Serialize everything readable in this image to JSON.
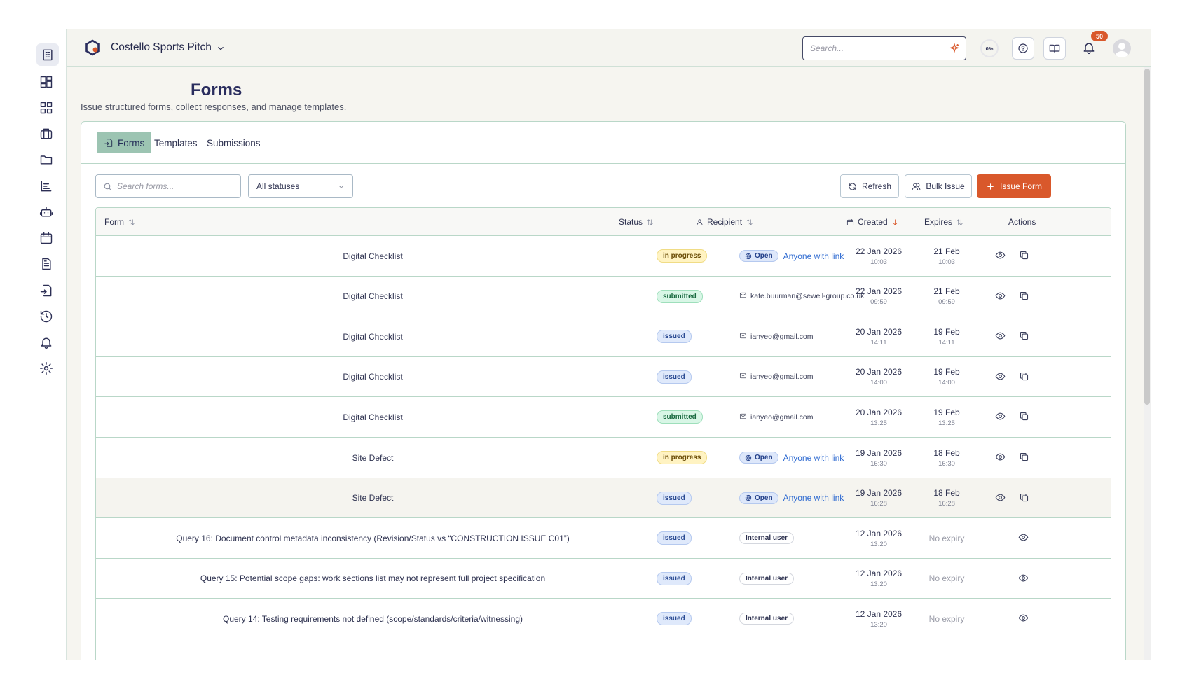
{
  "header": {
    "project_name": "Costello Sports Pitch",
    "search_placeholder": "Search...",
    "progress_label": "0%",
    "notification_count": "50"
  },
  "page": {
    "title": "Forms",
    "subtitle": "Issue structured forms, collect responses, and manage templates."
  },
  "tabs": [
    {
      "label": "Forms",
      "active": true
    },
    {
      "label": "Templates",
      "active": false
    },
    {
      "label": "Submissions",
      "active": false
    }
  ],
  "toolbar": {
    "search_placeholder": "Search forms...",
    "status_filter": "All statuses",
    "refresh_label": "Refresh",
    "bulk_issue_label": "Bulk Issue",
    "issue_form_label": "Issue Form"
  },
  "table": {
    "columns": {
      "form": "Form",
      "status": "Status",
      "recipient": "Recipient",
      "created": "Created",
      "expires": "Expires",
      "actions": "Actions"
    },
    "rows": [
      {
        "form": "Digital Checklist",
        "status": "in progress",
        "status_key": "in_progress",
        "recipient_type": "open",
        "open_label": "Open",
        "recipient": "Anyone with link",
        "created_date": "22 Jan 2026",
        "created_time": "10:03",
        "expires_date": "21 Feb",
        "expires_time": "10:03",
        "copyable": true
      },
      {
        "form": "Digital Checklist",
        "status": "submitted",
        "status_key": "submitted",
        "recipient_type": "email",
        "recipient": "kate.buurman@sewell-group.co.uk",
        "created_date": "22 Jan 2026",
        "created_time": "09:59",
        "expires_date": "21 Feb",
        "expires_time": "09:59",
        "copyable": true
      },
      {
        "form": "Digital Checklist",
        "status": "issued",
        "status_key": "issued",
        "recipient_type": "email",
        "recipient": "ianyeo@gmail.com",
        "created_date": "20 Jan 2026",
        "created_time": "14:11",
        "expires_date": "19 Feb",
        "expires_time": "14:11",
        "copyable": true
      },
      {
        "form": "Digital Checklist",
        "status": "issued",
        "status_key": "issued",
        "recipient_type": "email",
        "recipient": "ianyeo@gmail.com",
        "created_date": "20 Jan 2026",
        "created_time": "14:00",
        "expires_date": "19 Feb",
        "expires_time": "14:00",
        "copyable": true
      },
      {
        "form": "Digital Checklist",
        "status": "submitted",
        "status_key": "submitted",
        "recipient_type": "email",
        "recipient": "ianyeo@gmail.com",
        "created_date": "20 Jan 2026",
        "created_time": "13:25",
        "expires_date": "19 Feb",
        "expires_time": "13:25",
        "copyable": true
      },
      {
        "form": "Site Defect",
        "status": "in progress",
        "status_key": "in_progress",
        "recipient_type": "open",
        "open_label": "Open",
        "recipient": "Anyone with link",
        "created_date": "19 Jan 2026",
        "created_time": "16:30",
        "expires_date": "18 Feb",
        "expires_time": "16:30",
        "copyable": true
      },
      {
        "form": "Site Defect",
        "status": "issued",
        "status_key": "issued",
        "recipient_type": "open",
        "open_label": "Open",
        "recipient": "Anyone with link",
        "created_date": "19 Jan 2026",
        "created_time": "16:28",
        "expires_date": "18 Feb",
        "expires_time": "16:28",
        "copyable": true,
        "highlighted": true
      },
      {
        "form": "Query 16: Document control metadata inconsistency (Revision/Status vs “CONSTRUCTION ISSUE C01”)",
        "status": "issued",
        "status_key": "issued",
        "recipient_type": "internal",
        "recipient": "Internal user",
        "created_date": "12 Jan 2026",
        "created_time": "13:20",
        "expires_date": "No expiry",
        "expires_time": "",
        "copyable": false
      },
      {
        "form": "Query 15: Potential scope gaps: work sections list may not represent full project specification",
        "status": "issued",
        "status_key": "issued",
        "recipient_type": "internal",
        "recipient": "Internal user",
        "created_date": "12 Jan 2026",
        "created_time": "13:20",
        "expires_date": "No expiry",
        "expires_time": "",
        "copyable": false
      },
      {
        "form": "Query 14: Testing requirements not defined (scope/standards/criteria/witnessing)",
        "status": "issued",
        "status_key": "issued",
        "recipient_type": "internal",
        "recipient": "Internal user",
        "created_date": "12 Jan 2026",
        "created_time": "13:20",
        "expires_date": "No expiry",
        "expires_time": "",
        "copyable": false
      }
    ]
  },
  "colors": {
    "accent": "#d9582b",
    "tab_active": "#9cc4b2",
    "border": "#b9d7c8",
    "link": "#2f6bd1"
  }
}
